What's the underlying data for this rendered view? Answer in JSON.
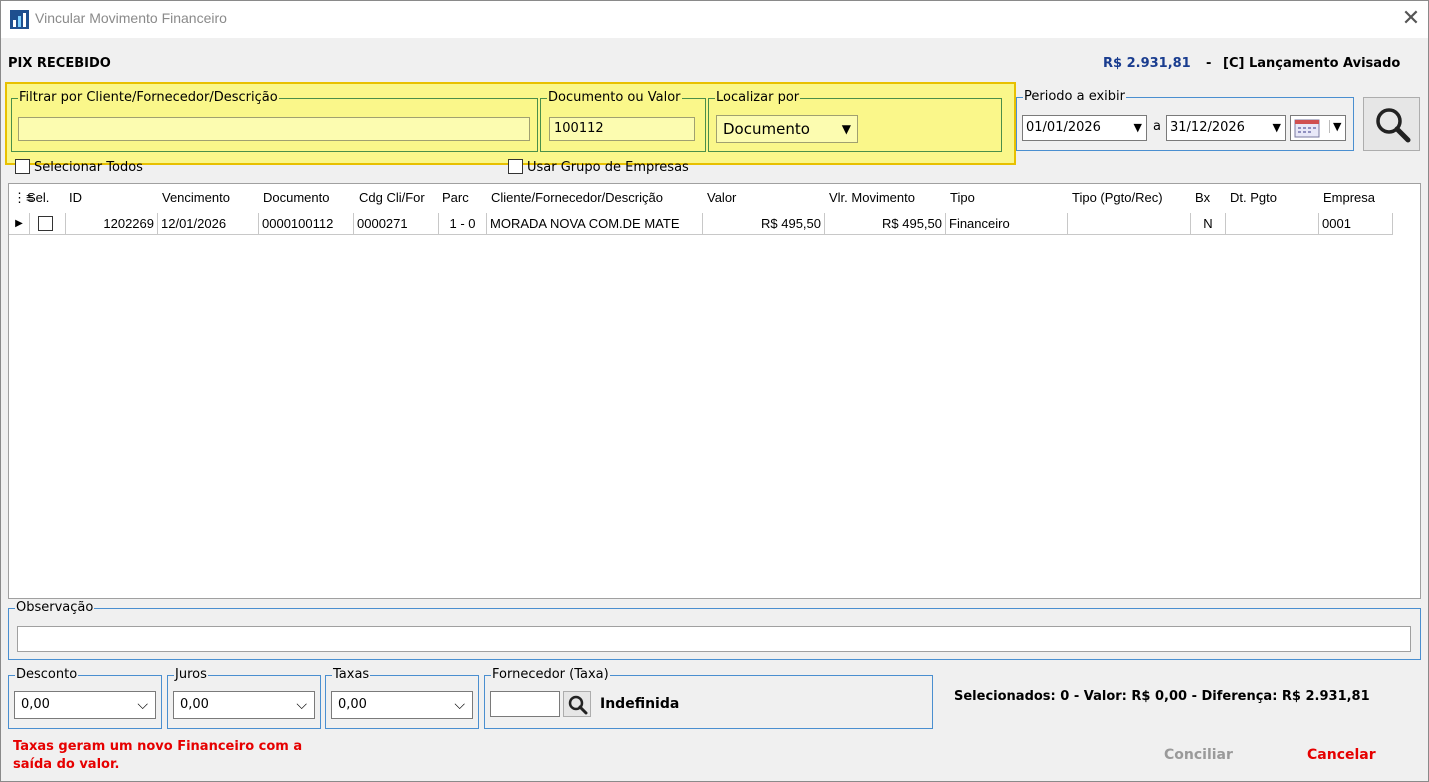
{
  "window": {
    "title": "Vincular Movimento Financeiro",
    "close_icon": "close-icon"
  },
  "header": {
    "left": "PIX RECEBIDO",
    "amount": "R$ 2.931,81",
    "separator": "-",
    "status": "[C] Lançamento Avisado"
  },
  "filters": {
    "cliente_label": "Filtrar por Cliente/Fornecedor/Descrição",
    "cliente_value": "",
    "doc_label": "Documento ou Valor",
    "doc_value": "100112",
    "localizar_label": "Localizar por",
    "localizar_value": "Documento",
    "periodo_label": "Periodo a exibir",
    "date_from": "01/01/2026",
    "date_sep": "a",
    "date_to": "31/12/2026",
    "selecionar_todos": "Selecionar Todos",
    "usar_grupo": "Usar Grupo de Empresas"
  },
  "grid": {
    "columns": [
      "Sel.",
      "ID",
      "Vencimento",
      "Documento",
      "Cdg Cli/For",
      "Parc",
      "Cliente/Fornecedor/Descrição",
      "Valor",
      "Vlr. Movimento",
      "Tipo",
      "Tipo (Pgto/Rec)",
      "Bx",
      "Dt. Pgto",
      "Empresa"
    ],
    "rows": [
      {
        "id": "1202269",
        "vencimento": "12/01/2026",
        "documento": "0000100112",
        "cdg": "0000271",
        "parc": "1 - 0",
        "cliente": "MORADA NOVA COM.DE MATE",
        "valor": "R$ 495,50",
        "vlr_mov": "R$ 495,50",
        "tipo": "Financeiro",
        "tipo_pgto": "",
        "bx": "N",
        "dt_pgto": "",
        "empresa": "0001"
      }
    ]
  },
  "observacao": {
    "label": "Observação",
    "value": ""
  },
  "bottom": {
    "desconto_label": "Desconto",
    "desconto_value": "0,00",
    "juros_label": "Juros",
    "juros_value": "0,00",
    "taxas_label": "Taxas",
    "taxas_value": "0,00",
    "fornecedor_label": "Fornecedor (Taxa)",
    "fornecedor_value": "",
    "fornecedor_name": "Indefinida",
    "summary": "Selecionados: 0  -  Valor: R$ 0,00  -  Diferença: R$ 2.931,81",
    "warning_line1": "Taxas geram um novo Financeiro com a",
    "warning_line2": "saída do valor.",
    "conciliar": "Conciliar",
    "cancelar": "Cancelar"
  },
  "colors": {
    "accent_blue": "#1a3d8f",
    "highlight_yellow": "#faf78a",
    "warning_red": "#e60000"
  }
}
